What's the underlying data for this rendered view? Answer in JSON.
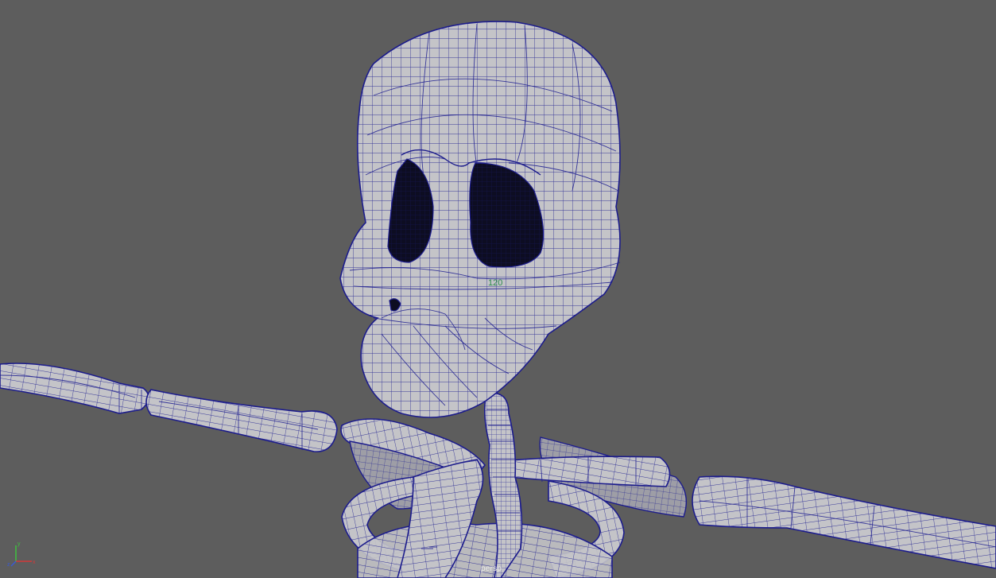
{
  "viewport": {
    "camera_label": "persp",
    "hud_value": "120",
    "background_color": "#5d5d5d",
    "wireframe_color": "#1c1c8c",
    "mesh_color": "#c4c4c8"
  },
  "axis_gizmo": {
    "x_label": "x",
    "y_label": "y",
    "z_label": "z",
    "x_color": "#d23a3a",
    "y_color": "#3ec23e",
    "z_color": "#3a5ad2"
  },
  "icons": [
    "axis-gizmo-icon"
  ]
}
